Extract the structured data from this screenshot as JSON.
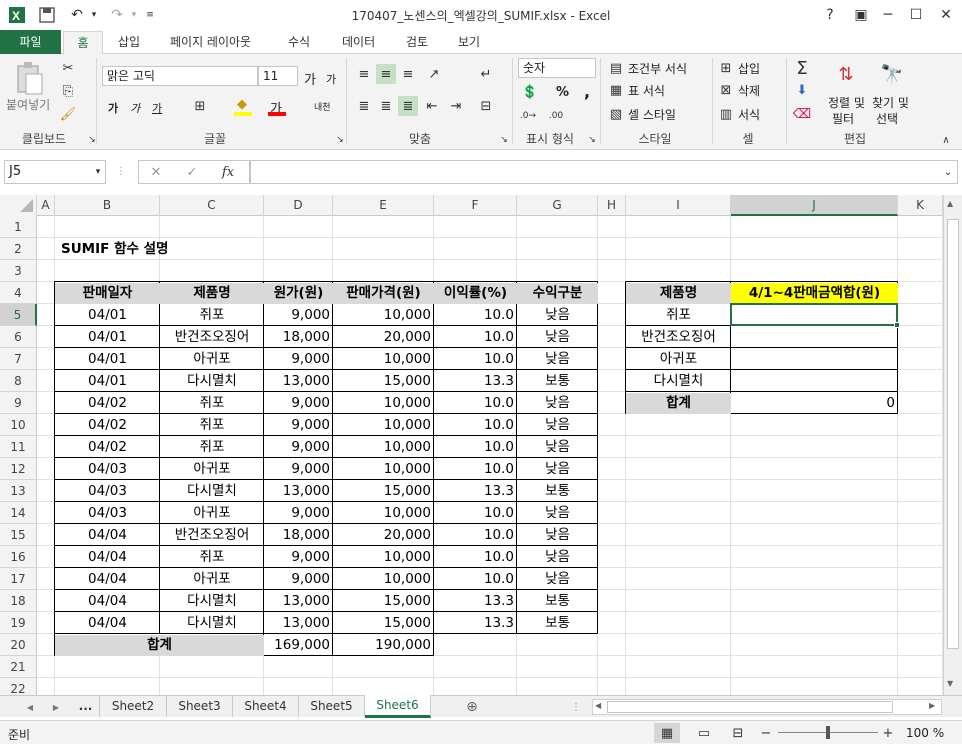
{
  "window": {
    "title": "170407_노센스의_엑셀강의_SUMIF.xlsx - Excel",
    "help": "?"
  },
  "tabs": {
    "file": "파일",
    "home": "홈",
    "insert": "삽입",
    "layout": "페이지 레이아웃",
    "formulas": "수식",
    "data": "데이터",
    "review": "검토",
    "view": "보기"
  },
  "ribbon": {
    "clipboard": {
      "paste": "붙여넣기",
      "label": "클립보드"
    },
    "font": {
      "name": "맑은 고딕",
      "size": "11",
      "grow": "가",
      "shrink": "가",
      "bold": "가",
      "italic": "가",
      "underline": "가",
      "color_letter": "가",
      "phonetic": "내천",
      "label": "글꼴"
    },
    "align": {
      "label": "맞춤"
    },
    "number": {
      "format": "숫자",
      "percent": "%",
      "comma": ",",
      "label": "표시 형식"
    },
    "styles": {
      "conditional": "조건부 서식",
      "table": "표 서식",
      "cell": "셀 스타일",
      "label": "스타일"
    },
    "cells": {
      "insert": "삽입",
      "delete": "삭제",
      "format": "서식",
      "label": "셀"
    },
    "editing": {
      "sort": "정렬 및",
      "sort2": "필터",
      "find": "찾기 및",
      "find2": "선택",
      "label": "편집"
    }
  },
  "formula_bar": {
    "name_box": "J5",
    "fx": "fx",
    "formula": ""
  },
  "columns": [
    "A",
    "B",
    "C",
    "D",
    "E",
    "F",
    "G",
    "H",
    "I",
    "J",
    "K"
  ],
  "rows": [
    "1",
    "2",
    "3",
    "4",
    "5",
    "6",
    "7",
    "8",
    "9",
    "10",
    "11",
    "12",
    "13",
    "14",
    "15",
    "16",
    "17",
    "18",
    "19",
    "20",
    "21",
    "22"
  ],
  "sheet": {
    "title": "SUMIF 함수 설명",
    "headers": [
      "판매일자",
      "제품명",
      "원가(원)",
      "판매가격(원)",
      "이익률(%)",
      "수익구분"
    ],
    "data": [
      [
        "04/01",
        "쥐포",
        "9,000",
        "10,000",
        "10.0",
        "낮음"
      ],
      [
        "04/01",
        "반건조오징어",
        "18,000",
        "20,000",
        "10.0",
        "낮음"
      ],
      [
        "04/01",
        "아귀포",
        "9,000",
        "10,000",
        "10.0",
        "낮음"
      ],
      [
        "04/01",
        "다시멸치",
        "13,000",
        "15,000",
        "13.3",
        "보통"
      ],
      [
        "04/02",
        "쥐포",
        "9,000",
        "10,000",
        "10.0",
        "낮음"
      ],
      [
        "04/02",
        "쥐포",
        "9,000",
        "10,000",
        "10.0",
        "낮음"
      ],
      [
        "04/02",
        "쥐포",
        "9,000",
        "10,000",
        "10.0",
        "낮음"
      ],
      [
        "04/03",
        "아귀포",
        "9,000",
        "10,000",
        "10.0",
        "낮음"
      ],
      [
        "04/03",
        "다시멸치",
        "13,000",
        "15,000",
        "13.3",
        "보통"
      ],
      [
        "04/03",
        "아귀포",
        "9,000",
        "10,000",
        "10.0",
        "낮음"
      ],
      [
        "04/04",
        "반건조오징어",
        "18,000",
        "20,000",
        "10.0",
        "낮음"
      ],
      [
        "04/04",
        "쥐포",
        "9,000",
        "10,000",
        "10.0",
        "낮음"
      ],
      [
        "04/04",
        "아귀포",
        "9,000",
        "10,000",
        "10.0",
        "낮음"
      ],
      [
        "04/04",
        "다시멸치",
        "13,000",
        "15,000",
        "13.3",
        "보통"
      ],
      [
        "04/04",
        "다시멸치",
        "13,000",
        "15,000",
        "13.3",
        "보통"
      ]
    ],
    "total_label": "합계",
    "total_cost": "169,000",
    "total_price": "190,000",
    "summary": {
      "header_name": "제품명",
      "header_value": "4/1~4판매금액합(원)",
      "items": [
        "쥐포",
        "반건조오징어",
        "아귀포",
        "다시멸치"
      ],
      "total_label": "합계",
      "total_value": "0"
    }
  },
  "sheet_tabs": [
    "...",
    "Sheet2",
    "Sheet3",
    "Sheet4",
    "Sheet5",
    "Sheet6"
  ],
  "active_sheet": "Sheet6",
  "status": {
    "ready": "준비",
    "zoom": "100 %"
  },
  "colors": {
    "brand": "#217346",
    "highlight": "#ffff00",
    "selected_header": "#d2d2d2"
  }
}
